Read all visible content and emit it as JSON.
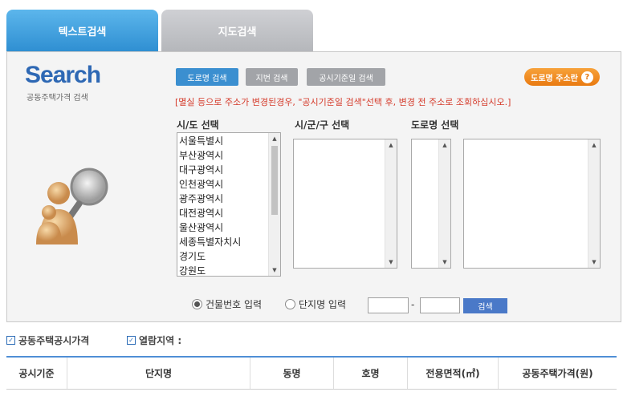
{
  "tabs": [
    {
      "label": "텍스트검색",
      "active": true
    },
    {
      "label": "지도검색",
      "active": false
    }
  ],
  "logo": {
    "word": "Search",
    "sub": "공동주택가격 검색"
  },
  "buttons": {
    "road": "도로명 검색",
    "jibun": "지번 검색",
    "date": "공시기준일 검색",
    "road_address_help": "도로명 주소란",
    "help_mark": "?",
    "search": "검색"
  },
  "notice": "[멸실 등으로 주소가 변경된경우, \"공시기준일 검색\"선택 후, 변경 전 주소로 조회하십시오.]",
  "labels": {
    "sido": "시/도 선택",
    "sigungu": "시/군/구 선택",
    "road": "도로명 선택"
  },
  "sido_options": [
    "서울특별시",
    "부산광역시",
    "대구광역시",
    "인천광역시",
    "광주광역시",
    "대전광역시",
    "울산광역시",
    "세종특별자치시",
    "경기도",
    "강원도"
  ],
  "radio": {
    "building": "건물번호 입력",
    "complex": "단지명 입력",
    "selected": "building"
  },
  "info": {
    "price": "공동주택공시가격",
    "area": "열람지역 :"
  },
  "table_headers": [
    "공시기준",
    "단지명",
    "동명",
    "호명",
    "전용면적(㎡)",
    "공동주택가격(원)"
  ],
  "colors": {
    "accent": "#3b8fd0",
    "orange": "#e97a10",
    "notice": "#d53a2a"
  },
  "icons": {
    "check": "square-check-icon",
    "illustration": "magnifier-person-icon"
  }
}
